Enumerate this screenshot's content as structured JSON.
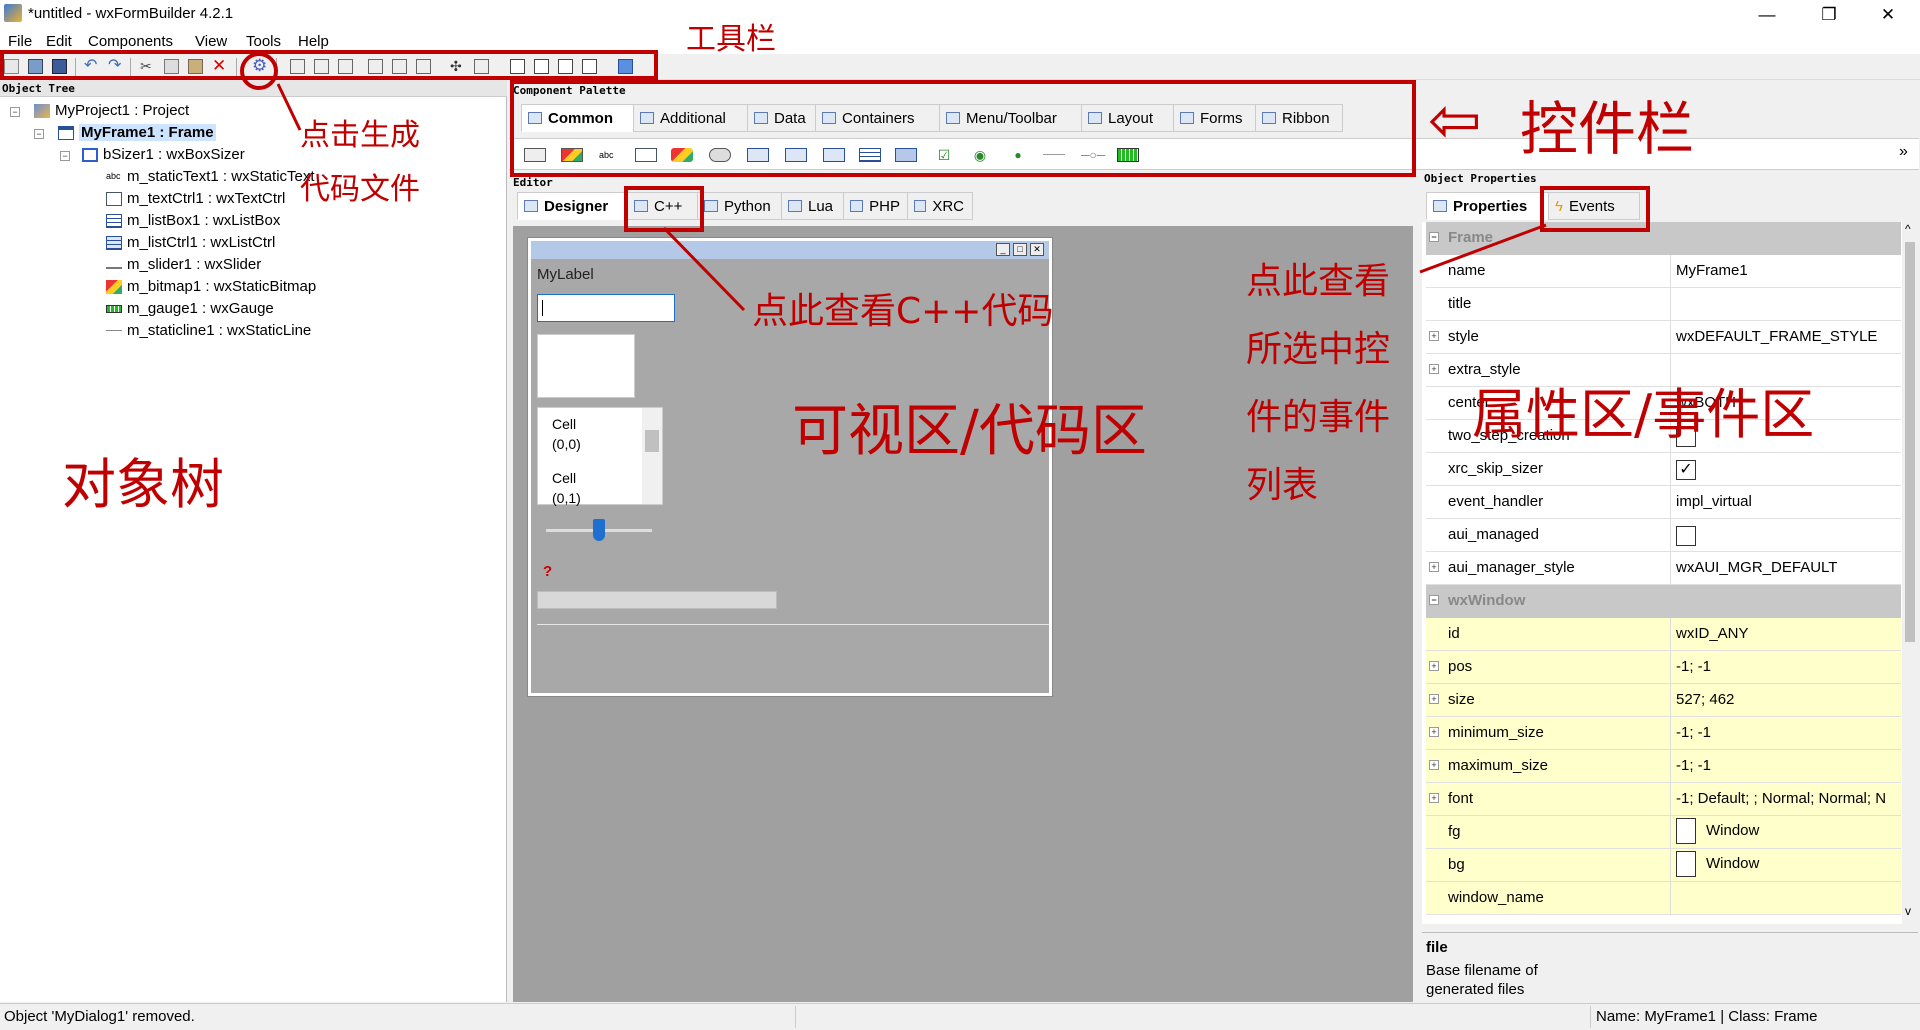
{
  "window": {
    "title": "*untitled - wxFormBuilder 4.2.1",
    "minimize": "—",
    "maximize": "❐",
    "close": "✕"
  },
  "menu": [
    "File",
    "Edit",
    "Components",
    "View",
    "Tools",
    "Help"
  ],
  "object_tree": {
    "panel_title": "Object Tree",
    "nodes": [
      "MyProject1 : Project",
      "MyFrame1 : Frame",
      "bSizer1 : wxBoxSizer",
      "m_staticText1 : wxStaticText",
      "m_textCtrl1 : wxTextCtrl",
      "m_listBox1 : wxListBox",
      "m_listCtrl1 : wxListCtrl",
      "m_slider1 : wxSlider",
      "m_bitmap1 : wxStaticBitmap",
      "m_gauge1 : wxGauge",
      "m_staticline1 : wxStaticLine"
    ],
    "abc_glyph": "abc"
  },
  "palette": {
    "panel_title": "Component Palette",
    "tabs": [
      "Common",
      "Additional",
      "Data",
      "Containers",
      "Menu/Toolbar",
      "Layout",
      "Forms",
      "Ribbon"
    ],
    "abc_glyph": "abc",
    "overflow": "»"
  },
  "editor": {
    "panel_title": "Editor",
    "tabs": [
      "Designer",
      "C++",
      "Python",
      "Lua",
      "PHP",
      "XRC"
    ],
    "preview": {
      "label": "MyLabel",
      "cell1": "Cell\n(0,0)",
      "cell2": "Cell\n(0,1)",
      "question": "?",
      "minimize": "_",
      "maximize": "□",
      "close": "✕"
    }
  },
  "object_properties": {
    "panel_title": "Object Properties",
    "tabs": [
      "Properties",
      "Events"
    ],
    "categories": [
      "Frame",
      "wxWindow"
    ],
    "rows_frame": [
      {
        "name": "name",
        "value": "MyFrame1"
      },
      {
        "name": "title",
        "value": ""
      },
      {
        "name": "style",
        "value": "wxDEFAULT_FRAME_STYLE"
      },
      {
        "name": "extra_style",
        "value": ""
      },
      {
        "name": "center",
        "value": "wxBOTH"
      },
      {
        "name": "two_step_creation",
        "value": ""
      },
      {
        "name": "xrc_skip_sizer",
        "value": ""
      },
      {
        "name": "event_handler",
        "value": "impl_virtual"
      },
      {
        "name": "aui_managed",
        "value": ""
      },
      {
        "name": "aui_manager_style",
        "value": "wxAUI_MGR_DEFAULT"
      }
    ],
    "rows_window": [
      {
        "name": "id",
        "value": "wxID_ANY"
      },
      {
        "name": "pos",
        "value": "-1; -1"
      },
      {
        "name": "size",
        "value": "527; 462"
      },
      {
        "name": "minimum_size",
        "value": "-1; -1"
      },
      {
        "name": "maximum_size",
        "value": "-1; -1"
      },
      {
        "name": "font",
        "value": "-1; Default; ; Normal; Normal; N"
      },
      {
        "name": "fg",
        "value": "Window"
      },
      {
        "name": "bg",
        "value": "Window"
      },
      {
        "name": "window_name",
        "value": ""
      }
    ],
    "help_title": "file",
    "help_text": "Base filename of generated files",
    "plus": "+",
    "minus": "−",
    "check": "✓",
    "scroll_up": "^",
    "scroll_down": "v"
  },
  "status": {
    "left": "Object 'MyDialog1' removed.",
    "right": "Name: MyFrame1 | Class: Frame"
  },
  "annotations": {
    "toolbar": "工具栏",
    "generate_line1": "点击生成",
    "generate_line2": "代码文件",
    "palette": "控件栏",
    "arrow": "⇦",
    "tree": "对象树",
    "view_cpp": "点此查看C++代码",
    "visual": "可视区/代码区",
    "events_line1": "点此查看",
    "events_line2": "所选中控",
    "events_line3": "件的事件",
    "events_line4": "列表",
    "props": "属性区/事件区"
  },
  "colors": {
    "annotation": "#c00000",
    "accent": "#1f6fd0",
    "property_highlight": "#ffffcc"
  }
}
